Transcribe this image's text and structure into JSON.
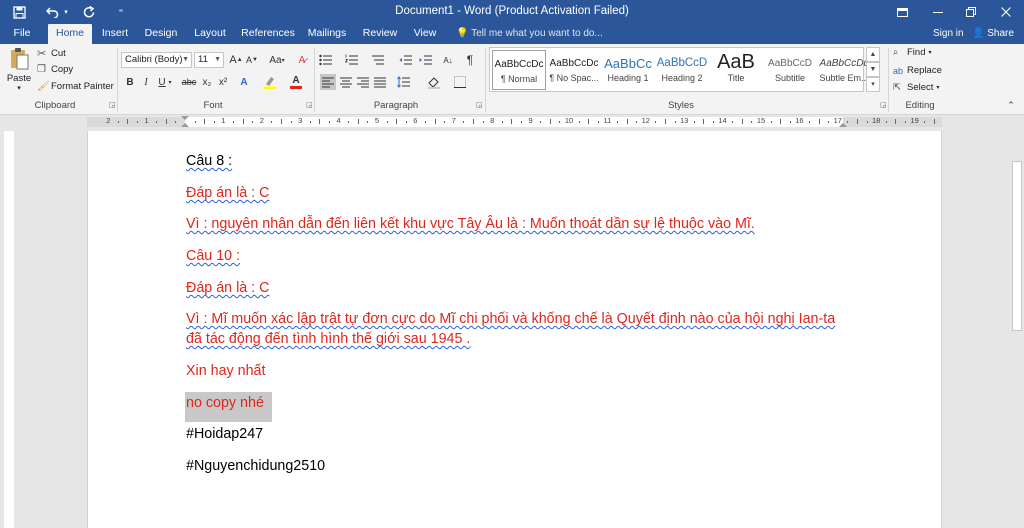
{
  "titlebar": {
    "title": "Document1 - Word (Product Activation Failed)",
    "icons": [
      "save-icon",
      "undo-icon",
      "redo-icon",
      "customize-qat-icon",
      "ribbon-display-icon",
      "minimize-icon",
      "restore-icon",
      "close-icon"
    ]
  },
  "tabs": {
    "file": "File",
    "home": "Home",
    "insert": "Insert",
    "design": "Design",
    "layout": "Layout",
    "references": "References",
    "mailings": "Mailings",
    "review": "Review",
    "view": "View",
    "tell_me": "Tell me what you want to do...",
    "sign_in": "Sign in",
    "share": "Share"
  },
  "ribbon": {
    "clipboard": {
      "paste": "Paste",
      "cut": "Cut",
      "copy": "Copy",
      "format_painter": "Format Painter",
      "label": "Clipboard"
    },
    "font": {
      "font_name": "Calibri (Body)",
      "font_size": "11",
      "bold": "B",
      "italic": "I",
      "underline": "U",
      "strikethrough": "abc",
      "subscript": "x₂",
      "superscript": "x²",
      "grow": "A",
      "shrink": "A",
      "case": "Aa",
      "text_effects": "A",
      "font_color": "A",
      "label": "Font"
    },
    "paragraph": {
      "label": "Paragraph"
    },
    "styles": {
      "label": "Styles",
      "items": [
        {
          "sample": "AaBbCcDc",
          "name": "¶ Normal"
        },
        {
          "sample": "AaBbCcDc",
          "name": "¶ No Spac..."
        },
        {
          "sample": "AaBbCc",
          "name": "Heading 1"
        },
        {
          "sample": "AaBbCcD",
          "name": "Heading 2"
        },
        {
          "sample": "AaB",
          "name": "Title"
        },
        {
          "sample": "AaBbCcD",
          "name": "Subtitle"
        },
        {
          "sample": "AaBbCcDc",
          "name": "Subtle Em..."
        }
      ]
    },
    "editing": {
      "find": "Find",
      "replace": "Replace",
      "select": "Select",
      "label": "Editing"
    }
  },
  "ruler": {
    "numbers": [
      "2",
      "1",
      "1",
      "2",
      "3",
      "4",
      "5",
      "6",
      "7",
      "8",
      "9",
      "10",
      "11",
      "12",
      "13",
      "14",
      "15",
      "16",
      "17",
      "18",
      "19"
    ]
  },
  "document": {
    "p1": "Câu 8 :",
    "p2": "Đáp án là : C",
    "p3_a": "Vì : nguyên nhân dẫn đến liên kết khu vực Tây Âu là : Muốn thoát dần sự lệ thuộc vào Mĩ.",
    "p4": "Câu 10 :",
    "p5": "Đáp án là : C",
    "p6_line1": "Vì : Mĩ muốn xác lập trật tự đơn cực do Mĩ chi phối và khống chế là Quyết định nào của hội nghị Ian-ta",
    "p6_line2": "đã tác động đến tình hình thế giới sau 1945 .",
    "p7": "Xin hay nhất",
    "p8": "no copy nhé",
    "p9": "#Hoidap247",
    "p10": "#Nguyenchidung2510"
  }
}
